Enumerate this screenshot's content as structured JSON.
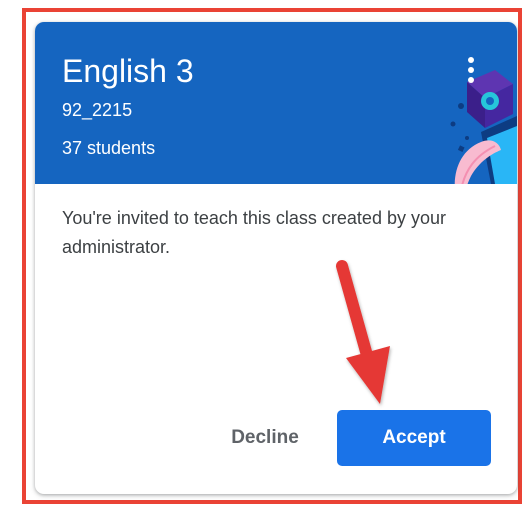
{
  "class_card": {
    "title": "English 3",
    "section": "92_2215",
    "student_count": "37 students",
    "more_options_icon": "more-vert-icon",
    "illustration_icon": "class-theme-illustration",
    "invite_message": "You're invited to teach this class created by your administrator.",
    "decline_label": "Decline",
    "accept_label": "Accept"
  },
  "annotation": {
    "arrow_icon": "red-arrow-icon"
  },
  "colors": {
    "header_bg": "#1565c0",
    "accept_bg": "#1a73e8",
    "highlight_border": "#ea4335",
    "arrow": "#e53935"
  }
}
